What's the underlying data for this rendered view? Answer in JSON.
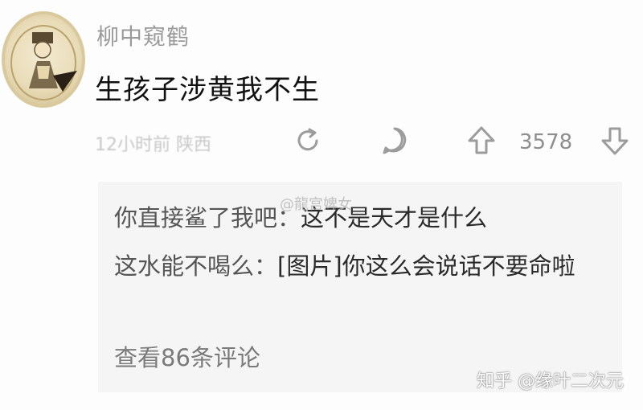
{
  "post": {
    "username": "柳中窥鹤",
    "content": "生孩子涉黄我不生",
    "meta": "12小时前 陕西",
    "vote_count": "3578"
  },
  "replies": [
    {
      "author": "你直接鲨了我吧：",
      "text": "这不是天才是什么"
    },
    {
      "author": "这水能不喝么：",
      "text": "[图片]你这么会说话不要命啦"
    }
  ],
  "view_more": "查看86条评论",
  "overlay": {
    "weibo_mark": "@龍宫婢女",
    "watermark": "知乎 @缘叶二次元"
  },
  "icons": {
    "retweet": "retweet-icon",
    "comment": "comment-icon",
    "upvote": "upvote-arrow-icon",
    "downvote": "downvote-arrow-icon"
  }
}
